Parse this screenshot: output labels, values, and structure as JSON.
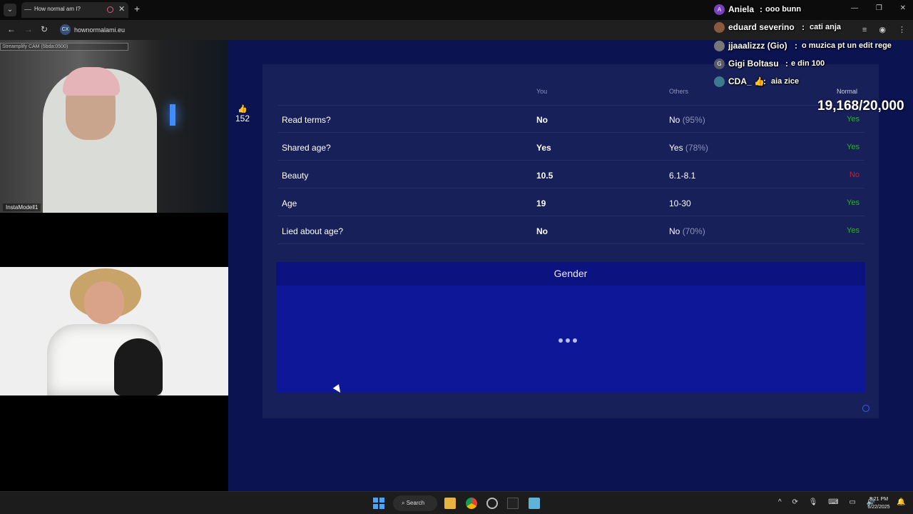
{
  "browser": {
    "tab_title": "How normal am I?",
    "url": "hownormalami.eu",
    "site_badge": "CX"
  },
  "cams": {
    "top_header": "Streamplify CAM (5bda:0500)",
    "top_label": "InstaModell1"
  },
  "likes": {
    "count": "152"
  },
  "table": {
    "headers": {
      "you": "You",
      "others": "Others",
      "normal": "Normal"
    },
    "rows": [
      {
        "question": "Read terms?",
        "you": "No",
        "others": "No",
        "others_pct": "(95%)",
        "normal": "Yes",
        "normal_status": "yes"
      },
      {
        "question": "Shared age?",
        "you": "Yes",
        "others": "Yes",
        "others_pct": "(78%)",
        "normal": "Yes",
        "normal_status": "yes"
      },
      {
        "question": "Beauty",
        "you": "10.5",
        "others": "6.1-8.1",
        "others_pct": "",
        "normal": "No",
        "normal_status": "no"
      },
      {
        "question": "Age",
        "you": "19",
        "others": "10-30",
        "others_pct": "",
        "normal": "Yes",
        "normal_status": "yes"
      },
      {
        "question": "Lied about age?",
        "you": "No",
        "others": "No",
        "others_pct": "(70%)",
        "normal": "Yes",
        "normal_status": "yes"
      }
    ]
  },
  "gender": {
    "title": "Gender"
  },
  "chat": [
    {
      "initial": "A",
      "user": "Aniela",
      "msg": "ooo bunn",
      "color": "#7b3fc4"
    },
    {
      "initial": "",
      "user": "eduard severino",
      "msg": "cati anja",
      "color": "#8b5a3c"
    },
    {
      "initial": "",
      "user": "jjaaalizzz (Gio)",
      "msg": "o muzica pt un edit rege",
      "color": "#777777"
    },
    {
      "initial": "G",
      "user": "Gigi Boltasu",
      "msg": "e din 100",
      "color": "#555a66"
    },
    {
      "initial": "",
      "user": "CDA_ 👍",
      "msg": "aia zice",
      "color": "#3c7a8f"
    }
  ],
  "counter": "19,168/20,000",
  "taskbar": {
    "search_label": "Search",
    "time": "8:21 PM",
    "date": "6/22/2025"
  },
  "colors": {
    "site_bg": "#0b1350",
    "panel_bg": "#18205a",
    "yes": "#2ab32a",
    "no": "#d41f2b",
    "gender_bg": "#0d1798"
  }
}
